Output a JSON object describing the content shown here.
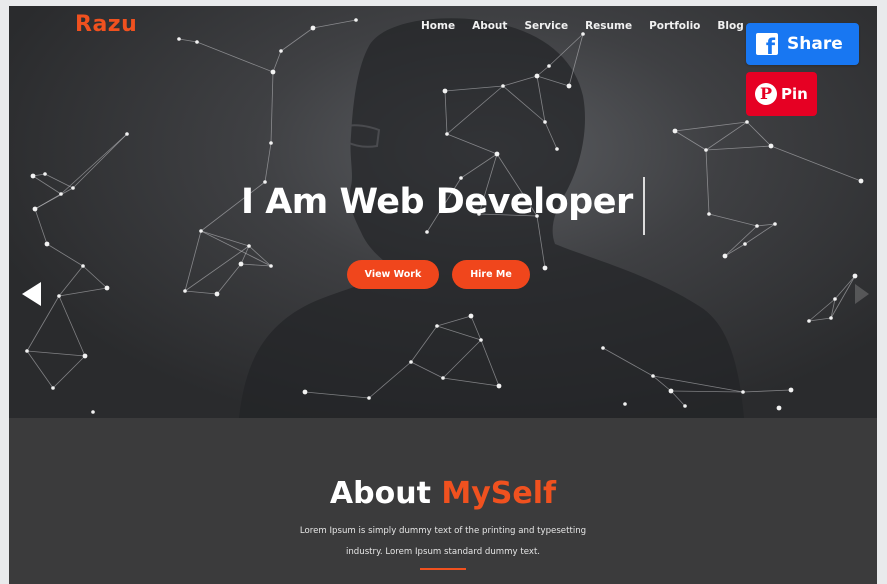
{
  "site": {
    "logo": "Razu",
    "nav": [
      "Home",
      "About",
      "Service",
      "Resume",
      "Portfolio",
      "Blog"
    ]
  },
  "hero": {
    "headline": "I Am Web Developer",
    "view_work_label": "View Work",
    "hire_me_label": "Hire Me"
  },
  "about": {
    "title_main": "About",
    "title_accent": "MySelf",
    "body_line1": "Lorem Ipsum is simply dummy text of the printing and typesetting",
    "body_line2": "industry. Lorem Ipsum standard dummy text."
  },
  "share": {
    "facebook_label": "Share",
    "pinterest_label": "Pin"
  },
  "colors": {
    "accent": "#f0511f",
    "button": "#f0461c",
    "facebook": "#1877f2",
    "pinterest": "#e60023",
    "about_bg": "#3b3b3c"
  },
  "icons": [
    "facebook-icon",
    "pinterest-icon",
    "chevron-left-icon",
    "chevron-right-icon"
  ]
}
